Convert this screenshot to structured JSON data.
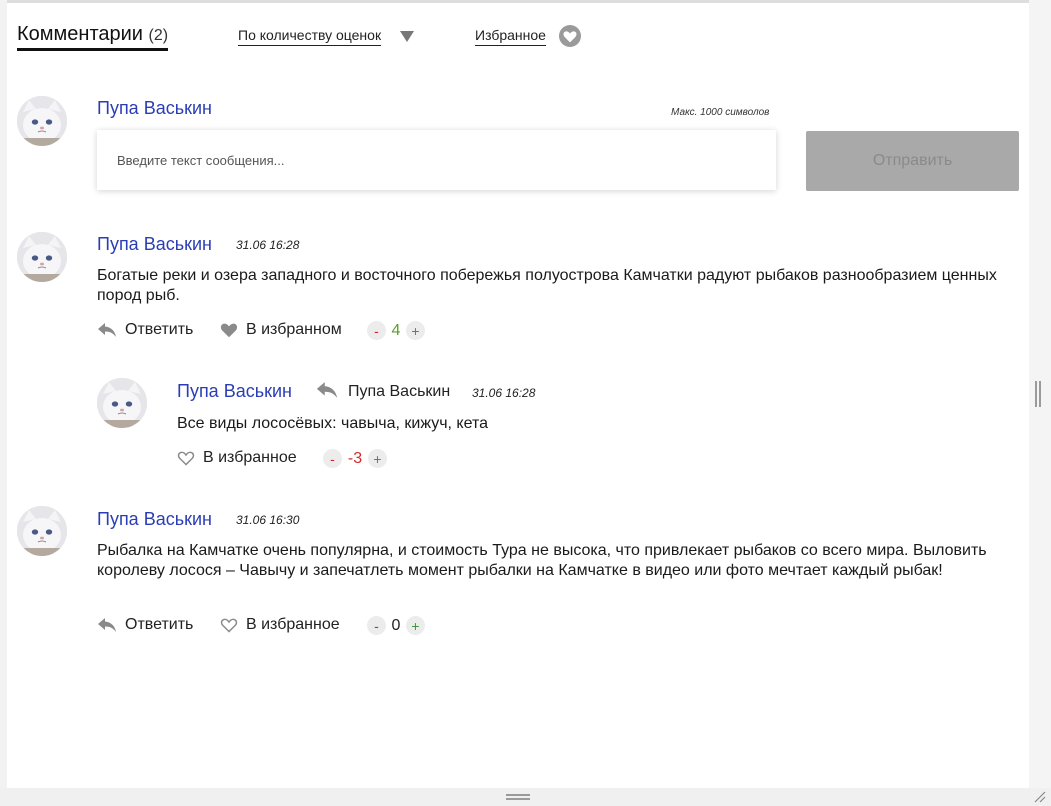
{
  "header": {
    "title": "Комментарии",
    "count": "(2)",
    "sort_label": "По количеству оценок",
    "favorites_label": "Избранное"
  },
  "composer": {
    "author": "Пупа Васькин",
    "max_note": "Макс. 1000 символов",
    "placeholder": "Введите текст сообщения...",
    "send_label": "Отправить"
  },
  "comments": [
    {
      "author": "Пупа Васькин",
      "date": "31.06 16:28",
      "text": "Богатые реки и озера западного и восточного побережья полуострова Камчатки радуют рыбаков разнообразием ценных пород рыб.",
      "reply_label": "Ответить",
      "favorite_label": "В избранном",
      "favorited": true,
      "votes": "4",
      "vote_minus": "-",
      "vote_plus": "+"
    },
    {
      "author": "Пупа Васькин",
      "reply_to": "Пупа Васькин",
      "date": "31.06 16:28",
      "text": "Все виды лососёвых: чавыча, кижуч, кета",
      "favorite_label": "В избранное",
      "favorited": false,
      "votes": "-3",
      "vote_minus": "-",
      "vote_plus": "+"
    },
    {
      "author": "Пупа Васькин",
      "date": "31.06 16:30",
      "text": "Рыбалка на Камчатке очень популярна, и стоимость Тура не высока, что привлекает рыбаков со всего мира. Выловить королеву лосося – Чавычу и запечатлеть момент рыбалки на Камчатке в видео или фото мечтает каждый рыбак!",
      "reply_label": "Ответить",
      "favorite_label": "В избранное",
      "favorited": false,
      "votes": "0",
      "vote_minus": "-",
      "vote_plus": "+"
    }
  ],
  "colors": {
    "author": "#2b3db5",
    "positive": "#5aa02c",
    "negative": "#d42a2a",
    "send_button": "#a9a9a9"
  },
  "icons": [
    "heart-icon",
    "reply-icon",
    "sort-arrow-icon",
    "avatar-cat-icon"
  ]
}
